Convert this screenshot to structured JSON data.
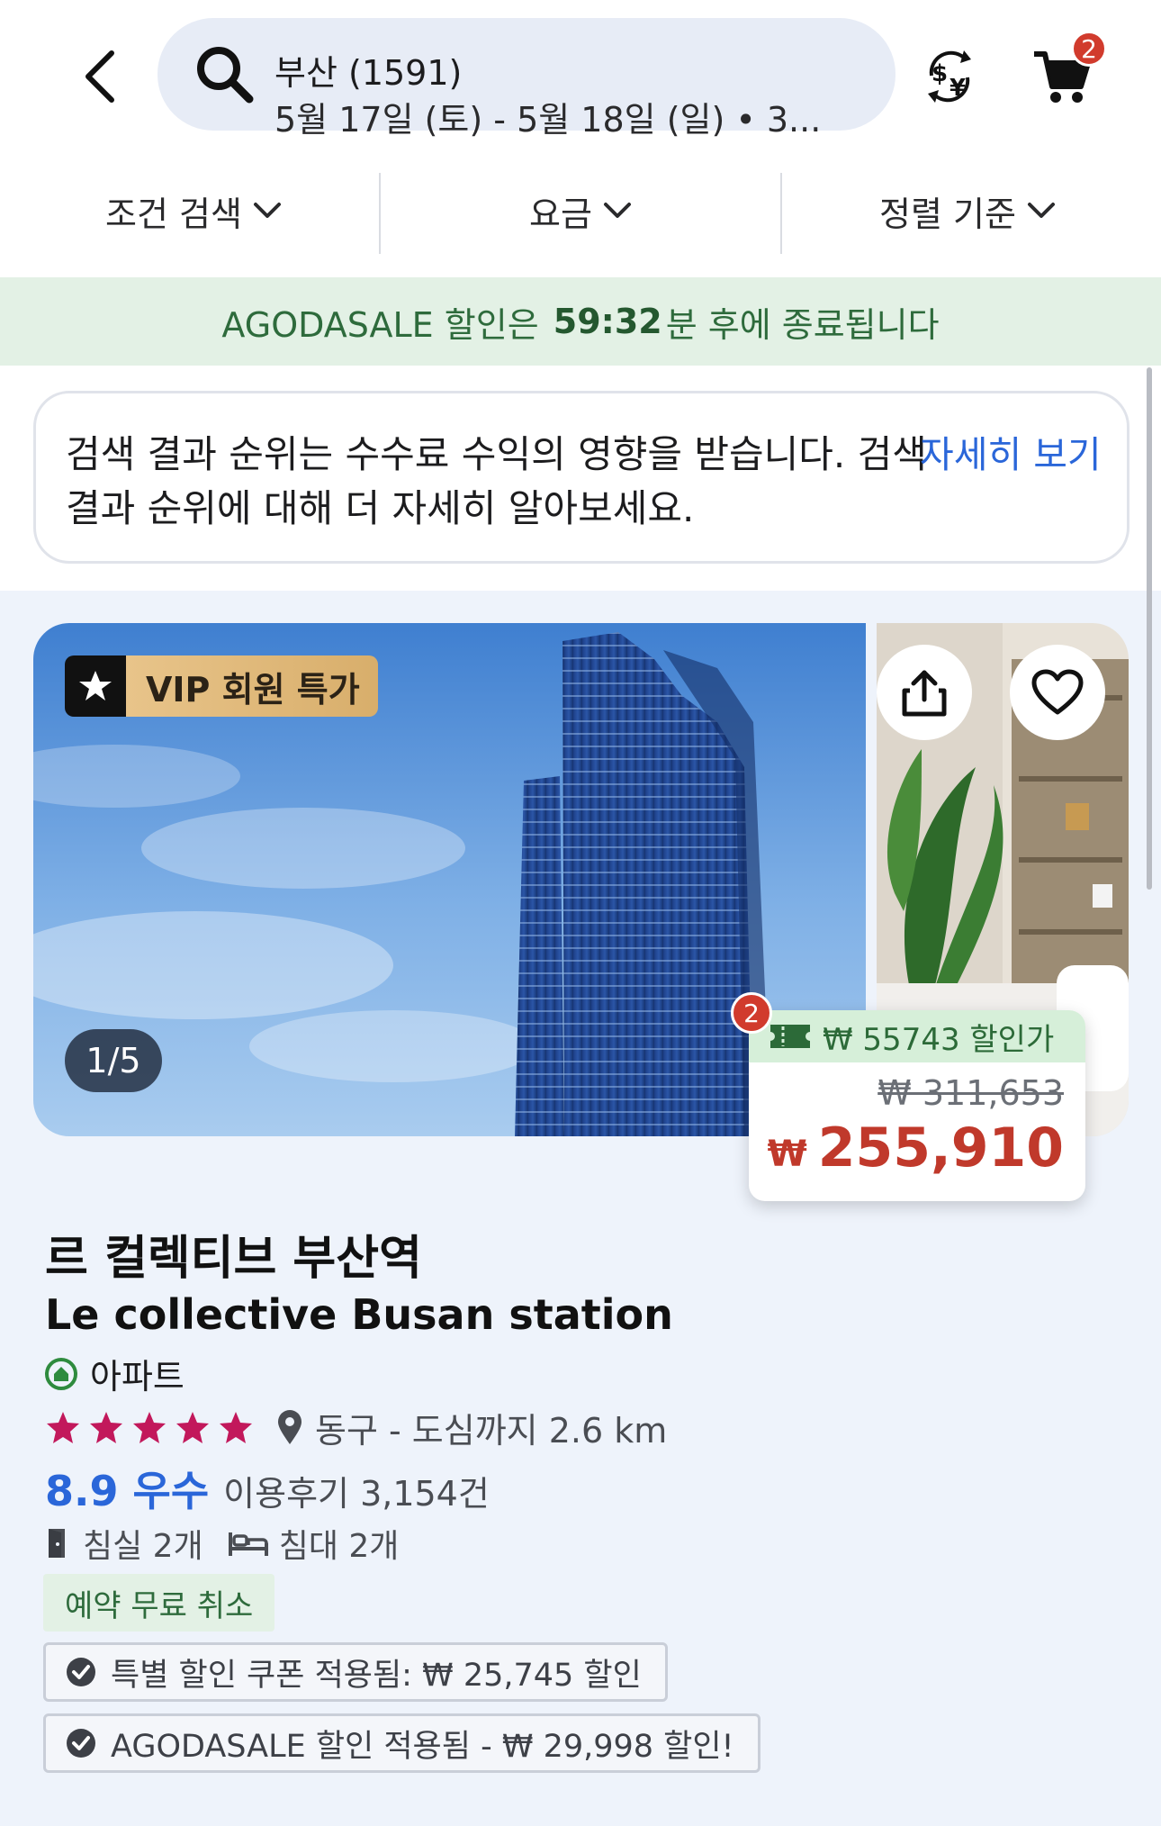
{
  "header": {
    "back_icon": "chevron-left-icon",
    "search_icon": "search-icon",
    "search_title": "부산 (1591)",
    "search_subtitle": "5월 17일 (토) - 5월 18일 (일) • 3...",
    "currency_icon": "currency-exchange-icon",
    "cart_icon": "cart-icon",
    "cart_count": "2"
  },
  "filters": [
    {
      "label": "조건 검색"
    },
    {
      "label": "요금"
    },
    {
      "label": "정렬 기준"
    }
  ],
  "sale_banner": {
    "prefix": "AGODASALE 할인은",
    "timer": "59:32",
    "suffix": "분 후에 종료됩니다"
  },
  "notice": {
    "text": "검색 결과 순위는 수수료 수익의 영향을 받습니다. 검색 결과 순위에 대해 더 자세히 알아보세요.",
    "link": "자세히 보기"
  },
  "listing": {
    "vip_badge": "VIP 회원 특가",
    "photo_counter": "1/5",
    "share_icon": "share-icon",
    "favorite_icon": "heart-icon",
    "price_badge_count": "2",
    "discount_label": "₩ 55743 할인가",
    "old_price": "₩ 311,653",
    "currency_symbol": "₩",
    "price": "255,910",
    "name_ko": "르 컬렉티브 부산역",
    "name_en": "Le collective Busan station",
    "property_type": "아파트",
    "stars": 5,
    "location": "동구 - 도심까지 2.6 km",
    "score": "8.9 우수",
    "reviews": "이용후기 3,154건",
    "bedrooms": "침실 2개",
    "beds": "침대 2개",
    "free_cancel": "예약 무료 취소",
    "promos": [
      "특별 할인 쿠폰 적용됨: ₩ 25,745 할인",
      "AGODASALE 할인 적용됨 - ₩ 29,998 할인!"
    ]
  },
  "colors": {
    "accent_blue": "#2a66d9",
    "price_red": "#c0392b",
    "sale_green": "#2e6b3c",
    "star_pink": "#c2185b"
  }
}
